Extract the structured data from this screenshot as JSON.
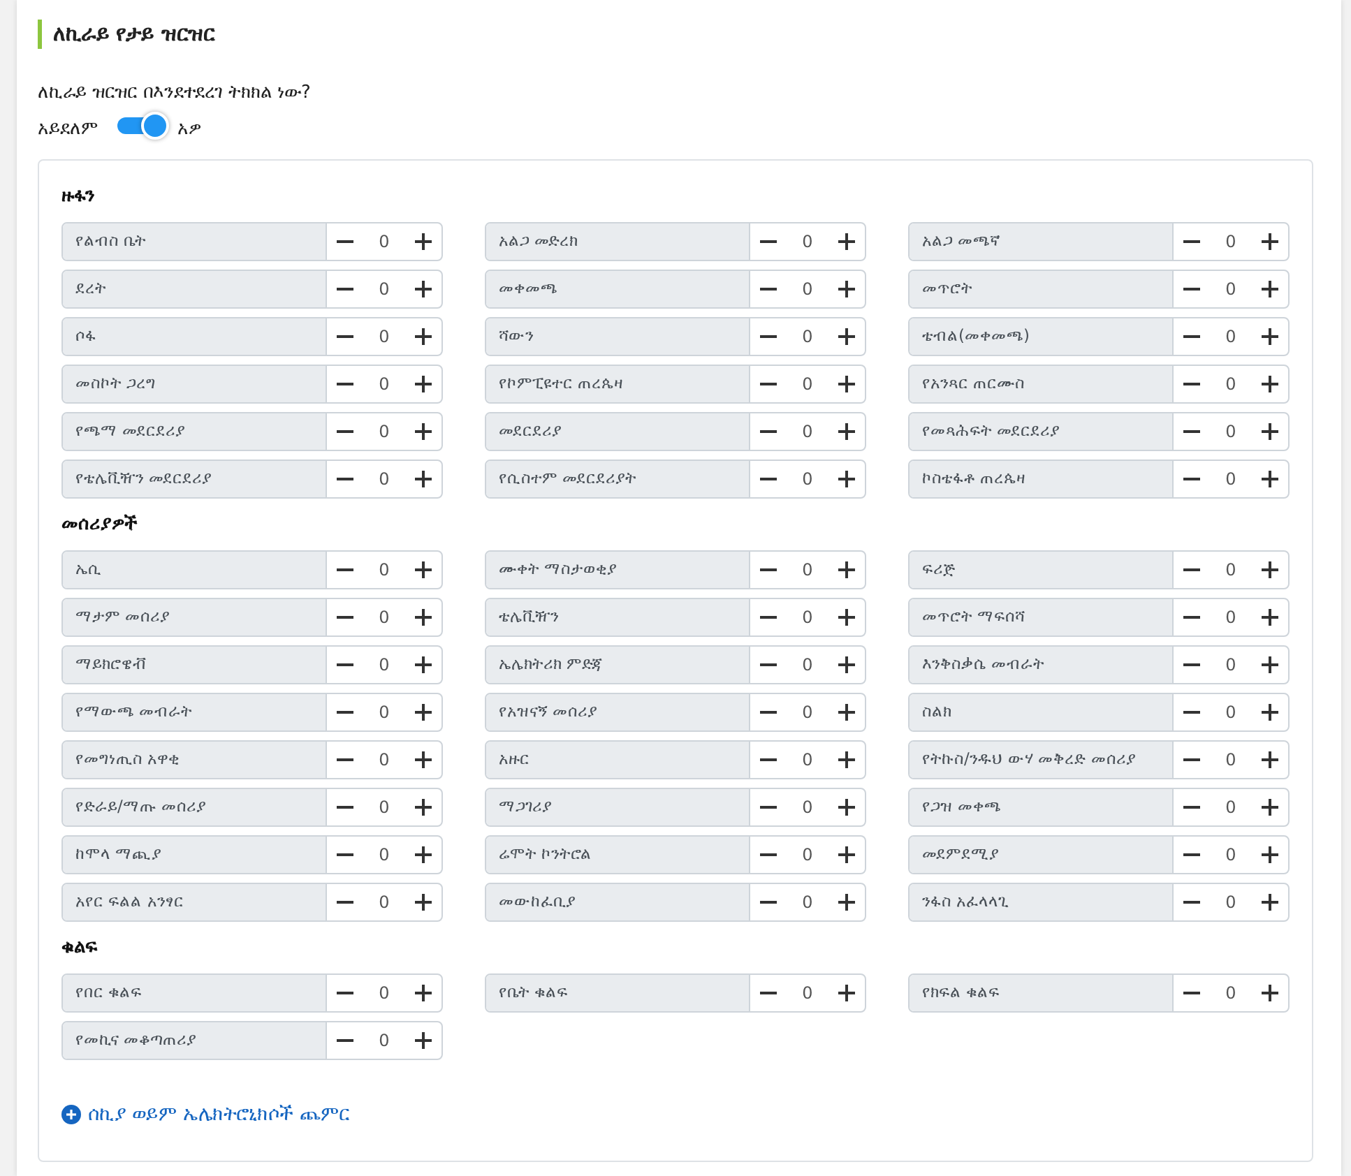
{
  "title": "ለኪራይ የታይ ዝርዝር",
  "confirmation": {
    "question": "ለኪራይ ዝርዝር በእንደተደረገ ትክክል ነው?",
    "off_label": "አይደለም",
    "on": true,
    "on_label": "አዎ"
  },
  "sections": [
    {
      "title": "ዙፋን",
      "items": [
        {
          "label": "የልብስ ቤት",
          "value": "0"
        },
        {
          "label": "አልጋ መድረክ",
          "value": "0"
        },
        {
          "label": "አልጋ መጫኛ",
          "value": "0"
        },
        {
          "label": "ደረት",
          "value": "0"
        },
        {
          "label": "መቀመጫ",
          "value": "0"
        },
        {
          "label": "መጥሮት",
          "value": "0"
        },
        {
          "label": "ሶፋ",
          "value": "0"
        },
        {
          "label": "ሻውን",
          "value": "0"
        },
        {
          "label": "ቴብል(መቀመጫ)",
          "value": "0"
        },
        {
          "label": "መስኮት ጋረግ",
          "value": "0"
        },
        {
          "label": "የኮምፒዩተር ጠረጴዛ",
          "value": "0"
        },
        {
          "label": "የአንጻር ጠርሙስ",
          "value": "0"
        },
        {
          "label": "የጫማ መደርደሪያ",
          "value": "0"
        },
        {
          "label": "መደርደሪያ",
          "value": "0"
        },
        {
          "label": "የመጻሕፍት መደርደሪያ",
          "value": "0"
        },
        {
          "label": "የቴሌቪዥን መደርደሪያ",
          "value": "0"
        },
        {
          "label": "የሲስተም መደርደሪያት",
          "value": "0"
        },
        {
          "label": "ኮስቴፋቶ ጠረጴዛ",
          "value": "0"
        }
      ]
    },
    {
      "title": "መሰሪያዎች",
      "items": [
        {
          "label": "ኤሲ",
          "value": "0"
        },
        {
          "label": "ሙቀት ማስታወቂያ",
          "value": "0"
        },
        {
          "label": "ፍሪጅ",
          "value": "0"
        },
        {
          "label": "ማታም መሰሪያ",
          "value": "0"
        },
        {
          "label": "ቴሌቪዥን",
          "value": "0"
        },
        {
          "label": "መጥሮት ማፍሰሻ",
          "value": "0"
        },
        {
          "label": "ማይክሮዌቭ",
          "value": "0"
        },
        {
          "label": "ኤሌክትሪክ ምድጃ",
          "value": "0"
        },
        {
          "label": "እንቅስቃሴ መብራት",
          "value": "0"
        },
        {
          "label": "የማውጫ መብራት",
          "value": "0"
        },
        {
          "label": "የአዝናኝ መሰሪያ",
          "value": "0"
        },
        {
          "label": "ስልክ",
          "value": "0"
        },
        {
          "label": "የመግነጢስ አዋቂ",
          "value": "0"
        },
        {
          "label": "አዙር",
          "value": "0"
        },
        {
          "label": "የትኩስ/ንዱህ ውሃ መቅረድ መሰሪያ",
          "value": "0"
        },
        {
          "label": "የድራይ/ማጡ መሰሪያ",
          "value": "0"
        },
        {
          "label": "ማጋገሪያ",
          "value": "0"
        },
        {
          "label": "የጋዝ መቀጫ",
          "value": "0"
        },
        {
          "label": "ከሞላ ማጪያ",
          "value": "0"
        },
        {
          "label": "ሬሞት ኮንትሮል",
          "value": "0"
        },
        {
          "label": "መደምደሚያ",
          "value": "0"
        },
        {
          "label": "አየር ፍልል አንፃር",
          "value": "0"
        },
        {
          "label": "መውከፈቢያ",
          "value": "0"
        },
        {
          "label": "ንፋስ አፈላላጊ",
          "value": "0"
        }
      ]
    },
    {
      "title": "ቁልፍ",
      "items": [
        {
          "label": "የበር ቁልፍ",
          "value": "0"
        },
        {
          "label": "የቤት ቁልፍ",
          "value": "0"
        },
        {
          "label": "የክፍል ቁልፍ",
          "value": "0"
        },
        {
          "label": "የመኪና መቆጣጠሪያ",
          "value": "0"
        }
      ]
    }
  ],
  "add_link": {
    "label": "ሰኪያ ወይም ኤሌክትሮኒክሶች ጨምር"
  }
}
